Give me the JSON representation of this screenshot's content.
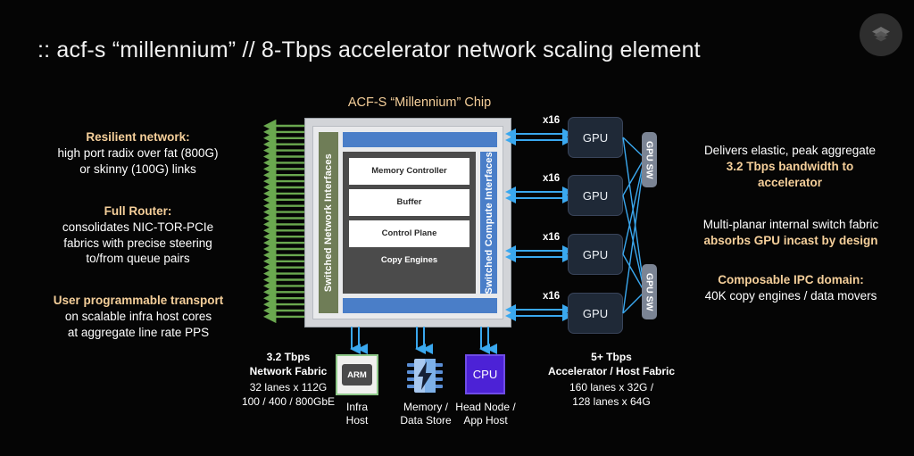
{
  "slide": {
    "title": ":: acf-s “millennium” // 8-Tbps accelerator network scaling element",
    "background_color": "#050505",
    "accent_color": "#f5cf9a"
  },
  "logo": {
    "name": "stacked-layers-logo",
    "color": "#2e2e2e"
  },
  "left_annotations": [
    {
      "heading": "Resilient network:",
      "lines": [
        "high port radix over fat (800G)",
        "or skinny (100G) links"
      ]
    },
    {
      "heading": "Full Router:",
      "lines": [
        "consolidates NIC-TOR-PCIe",
        "fabrics with precise steering",
        "to/from queue pairs"
      ]
    },
    {
      "heading": "User programmable transport",
      "lines": [
        "on scalable infra host cores",
        "at aggregate line rate PPS"
      ]
    }
  ],
  "right_annotations": [
    {
      "lines_plain_first": [
        "Delivers elastic, peak aggregate"
      ],
      "lines_accent": [
        "3.2 Tbps bandwidth to",
        "accelerator"
      ]
    },
    {
      "lines_plain_first": [
        "Multi-planar internal switch fabric"
      ],
      "lines_accent": [
        "absorbs GPU incast by design"
      ]
    },
    {
      "lines_accent_first": [
        "Composable IPC domain:"
      ],
      "lines_plain": [
        "40K copy engines / data movers"
      ]
    }
  ],
  "right_ann_1": {
    "plain": "Delivers elastic, peak aggregate",
    "accent_1": "3.2 Tbps bandwidth to",
    "accent_2": "accelerator"
  },
  "right_ann_2": {
    "plain": "Multi-planar internal switch fabric",
    "accent": "absorbs GPU incast by design"
  },
  "right_ann_3": {
    "accent": "Composable IPC domain:",
    "plain": "40K copy engines / data movers"
  },
  "chip": {
    "title": "ACF-S “Millennium” Chip",
    "network_interfaces_label": "Switched Network Interfaces",
    "compute_interfaces_label": "Switched Compute Interfaces",
    "core_blocks": [
      "Memory Controller",
      "Buffer",
      "Control Plane"
    ],
    "copy_engines_label": "Copy Engines",
    "colors": {
      "network_bar": "#6f7d57",
      "compute_bar": "#4a7ec8",
      "blue_bar": "#4a7ec8",
      "core": "#4b4b4b",
      "frame": "#d2d4d8"
    }
  },
  "gpus": [
    {
      "label": "GPU",
      "lanes": "x16"
    },
    {
      "label": "GPU",
      "lanes": "x16"
    },
    {
      "label": "GPU",
      "lanes": "x16"
    },
    {
      "label": "GPU",
      "lanes": "x16"
    }
  ],
  "gpu_switches": [
    {
      "label": "GPU SW"
    },
    {
      "label": "GPU SW"
    }
  ],
  "bottom_devices": [
    {
      "icon": "arm-chip-icon",
      "chip_text": "ARM",
      "label_line_1": "Infra",
      "label_line_2": "Host"
    },
    {
      "icon": "memory-bolt-icon",
      "chip_text": "",
      "label_line_1": "Memory /",
      "label_line_2": "Data Store"
    },
    {
      "icon": "cpu-icon",
      "chip_text": "CPU",
      "label_line_1": "Head Node /",
      "label_line_2": "App Host"
    }
  ],
  "fabric_captions": {
    "left": {
      "title_1": "3.2 Tbps",
      "title_2": "Network Fabric",
      "sub_1": "32 lanes x 112G",
      "sub_2": "100 / 400 / 800GbE"
    },
    "right": {
      "title_1": "5+ Tbps",
      "title_2": "Accelerator / Host Fabric",
      "sub_1": "160 lanes x 32G /",
      "sub_2": "128 lanes x 64G"
    }
  }
}
